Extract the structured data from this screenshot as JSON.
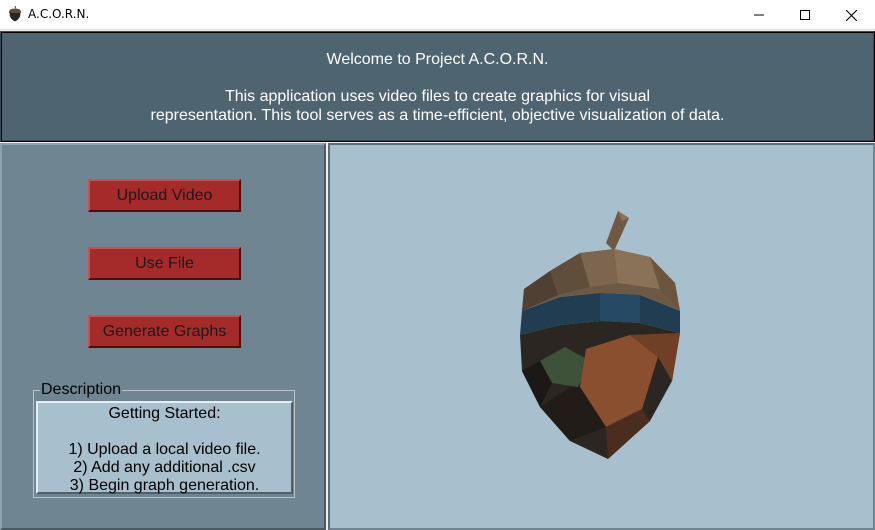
{
  "window": {
    "title": "A.C.O.R.N.",
    "app_icon": "acorn-icon",
    "controls": [
      "minimize-icon",
      "maximize-icon",
      "close-icon"
    ]
  },
  "header": {
    "title": "Welcome to Project A.C.O.R.N.",
    "description_line1": "This application uses video files to create graphics for visual",
    "description_line2": "representation. This tool serves as a time-efficient, objective visualization of data."
  },
  "sidebar": {
    "buttons": {
      "upload": "Upload Video",
      "use_file": "Use File",
      "generate": "Generate Graphs"
    },
    "description": {
      "legend": "Description",
      "heading": "Getting Started:",
      "steps": [
        "1) Upload a local video file.",
        "2) Add any additional .csv",
        "3) Begin graph generation."
      ]
    }
  },
  "preview": {
    "image": "acorn-3d-illustration"
  },
  "colors": {
    "header_bg": "#4e6470",
    "sidebar_bg": "#6f8591",
    "preview_bg": "#a8bfcd",
    "button_bg": "#a52a2a"
  }
}
